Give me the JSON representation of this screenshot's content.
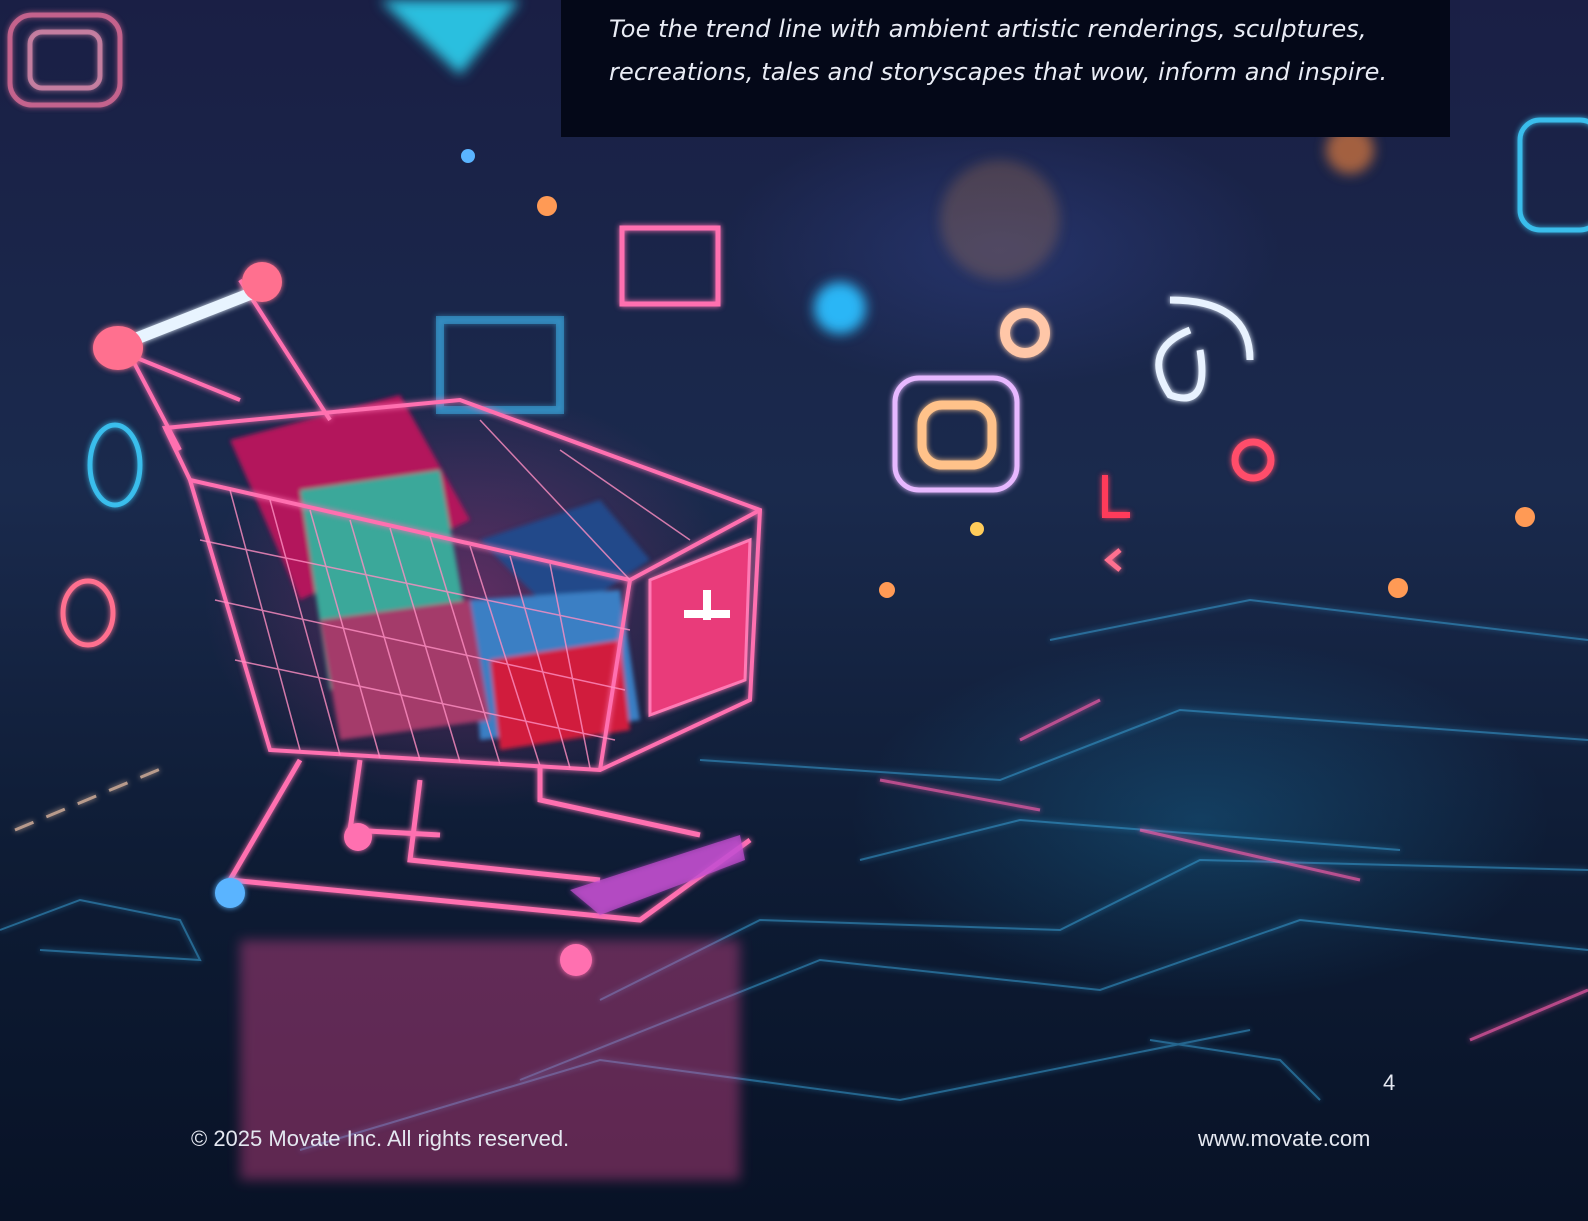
{
  "quote": {
    "lines": [
      "Toe the trend line with ambient artistic renderings, sculptures,",
      "recreations, tales and storyscapes that wow, inform and inspire."
    ]
  },
  "footer": {
    "copyright": "© 2025 Movate Inc. All rights reserved.",
    "website": "www.movate.com",
    "page_number": "4"
  },
  "colors": {
    "quote_box_bg": "#040818",
    "neon_pink": "#ff4d9d",
    "neon_cyan": "#3fd0ff",
    "text": "#e9ecf5"
  }
}
